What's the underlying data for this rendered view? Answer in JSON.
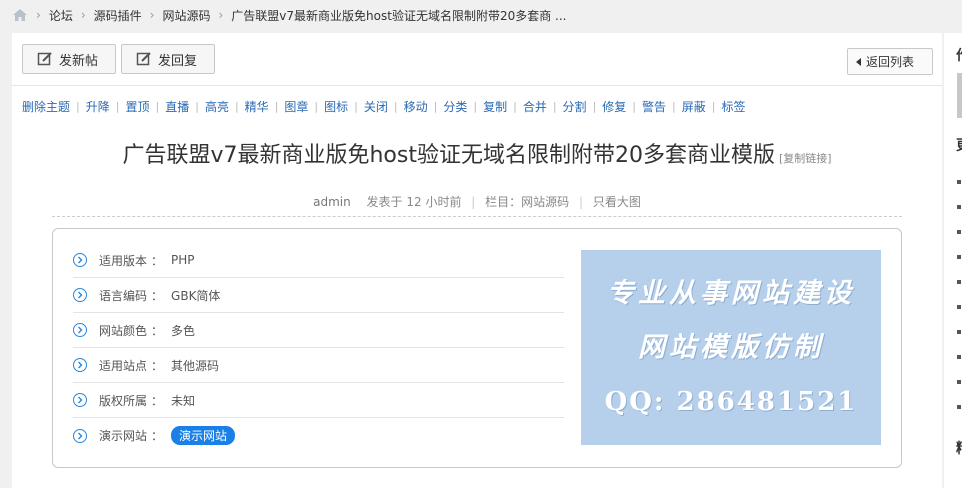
{
  "breadcrumb": {
    "items": [
      "论坛",
      "源码插件",
      "网站源码",
      "广告联盟v7最新商业版免host验证无域名限制附带20多套商 ..."
    ]
  },
  "toolbar": {
    "new_post": "发新帖",
    "reply": "发回复",
    "back": "返回列表"
  },
  "mod_actions": [
    "删除主题",
    "升降",
    "置顶",
    "直播",
    "高亮",
    "精华",
    "图章",
    "图标",
    "关闭",
    "移动",
    "分类",
    "复制",
    "合并",
    "分割",
    "修复",
    "警告",
    "屏蔽",
    "标签"
  ],
  "thread": {
    "title": "广告联盟v7最新商业版免host验证无域名限制附带20多套商业模版",
    "copy_link": "[复制链接]",
    "author": "admin",
    "posted": "发表于 12 小时前",
    "column": "栏目：网站源码",
    "view_image": "只看大图"
  },
  "info": {
    "rows": [
      {
        "label": "适用版本",
        "colon": "：",
        "value": "PHP"
      },
      {
        "label": "语言编码",
        "colon": "：",
        "value": "GBK简体"
      },
      {
        "label": "网站颜色",
        "colon": "：",
        "value": "多色"
      },
      {
        "label": "适用站点",
        "colon": "：",
        "value": "其他源码"
      },
      {
        "label": "版权所属",
        "colon": "：",
        "value": "未知"
      },
      {
        "label": "演示网站",
        "colon": "：",
        "value": "演示网站"
      }
    ]
  },
  "banner": {
    "line1": "专业从事网站建设",
    "line2": "网站模版仿制",
    "line3": "QQ: 286481521"
  },
  "sidebar": {
    "fragment_chars": [
      "作",
      "更",
      "精"
    ]
  },
  "colors": {
    "link": "#2a6ab5",
    "accent_blue": "#1a7fe6",
    "banner_bg": "#b6d0ec"
  }
}
